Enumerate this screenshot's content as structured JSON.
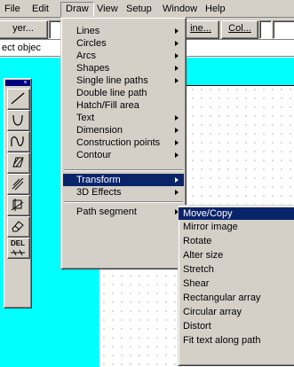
{
  "menubar": {
    "items": [
      {
        "label": "File"
      },
      {
        "label": "Edit"
      },
      {
        "label": "Draw"
      },
      {
        "label": "View"
      },
      {
        "label": "Setup"
      },
      {
        "label": "Window"
      },
      {
        "label": "Help"
      }
    ]
  },
  "toolbar": {
    "layer_label": "yer...",
    "line_label": "ine...",
    "color_label": "Col..."
  },
  "prompt": {
    "text": "ect objec"
  },
  "palette": {
    "delete_label": "DEL"
  },
  "draw_menu": {
    "groups": [
      [
        {
          "label": "Lines",
          "submenu": true
        },
        {
          "label": "Circles",
          "submenu": true
        },
        {
          "label": "Arcs",
          "submenu": true
        },
        {
          "label": "Shapes",
          "submenu": true
        },
        {
          "label": "Single line paths",
          "submenu": true
        },
        {
          "label": "Double line path",
          "submenu": false
        },
        {
          "label": "Hatch/Fill area",
          "submenu": false
        },
        {
          "label": "Text",
          "submenu": true
        },
        {
          "label": "Dimension",
          "submenu": true
        },
        {
          "label": "Construction points",
          "submenu": true
        },
        {
          "label": "Contour",
          "submenu": true
        }
      ],
      [
        {
          "label": "Transform",
          "submenu": true,
          "highlighted": true
        },
        {
          "label": "3D Effects",
          "submenu": true
        }
      ],
      [
        {
          "label": "Path segment",
          "submenu": true
        }
      ]
    ]
  },
  "transform_menu": {
    "items": [
      {
        "label": "Move/Copy",
        "highlighted": true
      },
      {
        "label": "Mirror image"
      },
      {
        "label": "Rotate"
      },
      {
        "label": "Alter size"
      },
      {
        "label": "Stretch"
      },
      {
        "label": "Shear"
      },
      {
        "label": "Rectangular array"
      },
      {
        "label": "Circular array"
      },
      {
        "label": "Distort"
      },
      {
        "label": "Fit text along path"
      }
    ]
  },
  "colors": {
    "canvas": "#00ffff",
    "menu_face": "#d4d0c8",
    "highlight": "#0a246a"
  }
}
